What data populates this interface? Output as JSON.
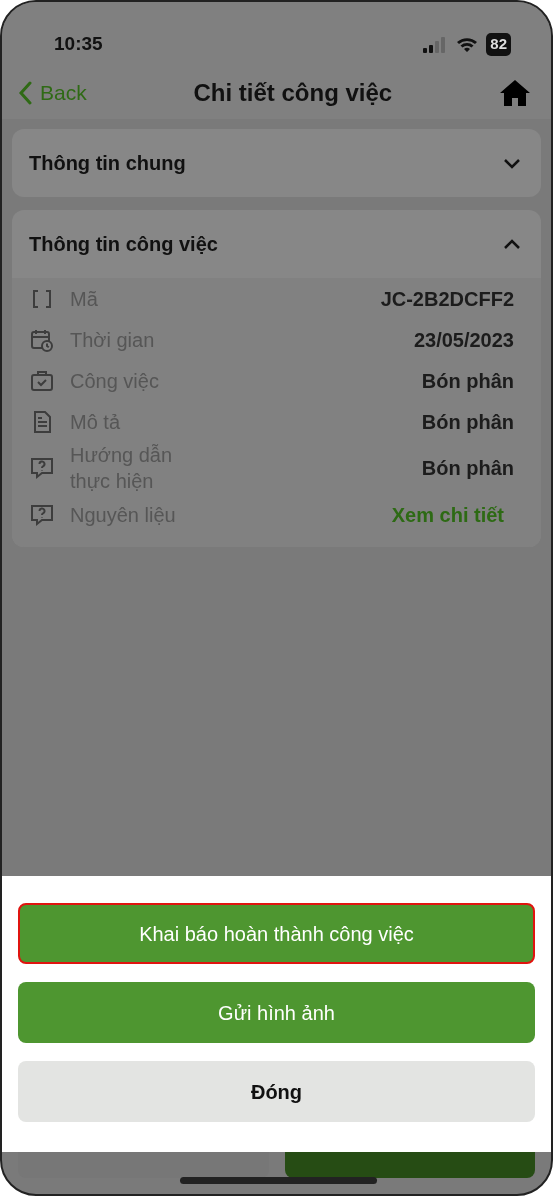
{
  "status_bar": {
    "time": "10:35",
    "battery": "82"
  },
  "nav": {
    "back": "Back",
    "title": "Chi tiết công việc"
  },
  "sections": [
    {
      "title": "Thông tin chung",
      "expanded": false
    },
    {
      "title": "Thông tin công việc",
      "expanded": true,
      "rows": [
        {
          "label": "Mã",
          "value": "JC-2B2DCFF2",
          "kind": "text"
        },
        {
          "label": "Thời gian",
          "value": "23/05/2023",
          "kind": "text"
        },
        {
          "label": "Công việc",
          "value": "Bón phân",
          "kind": "text"
        },
        {
          "label": "Mô tả",
          "value": "Bón phân",
          "kind": "text"
        },
        {
          "label": "Hướng dẫn thực hiện",
          "value": "Bón phân",
          "kind": "text"
        },
        {
          "label": "Nguyên liệu",
          "value": "Xem chi tiết",
          "kind": "link"
        }
      ]
    }
  ],
  "sheet": {
    "buttons": [
      {
        "label": "Khai báo hoàn thành công việc",
        "kind": "primary",
        "focused": true
      },
      {
        "label": "Gửi hình ảnh",
        "kind": "primary",
        "focused": false
      },
      {
        "label": "Đóng",
        "kind": "secondary",
        "focused": false
      }
    ]
  }
}
